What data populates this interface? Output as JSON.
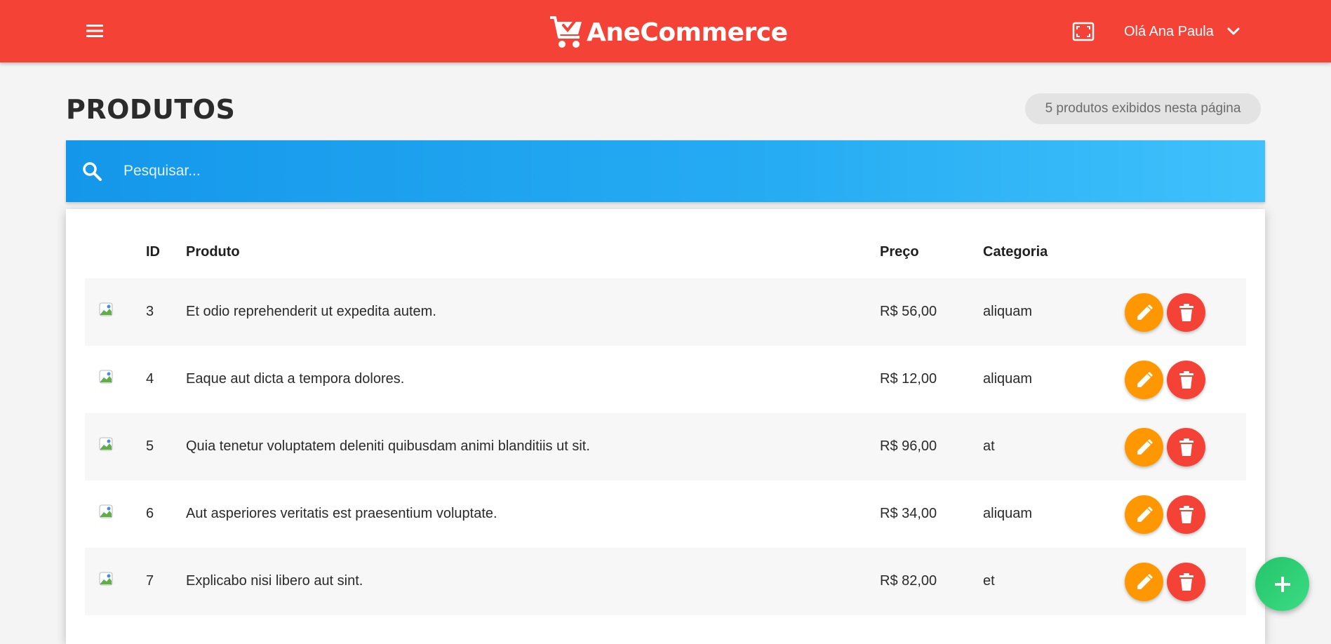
{
  "header": {
    "brand": "AneCommerce",
    "greeting": "Olá Ana Paula",
    "icons": [
      "menu-icon",
      "cart-check-icon",
      "fullscreen-icon",
      "chevron-down-icon"
    ],
    "color": "#f44336"
  },
  "page": {
    "title": "PRODUTOS",
    "count_badge": "5 produtos exibidos nesta página"
  },
  "search": {
    "placeholder": "Pesquisar...",
    "icon": "search-icon"
  },
  "table": {
    "columns": {
      "id": "ID",
      "product": "Produto",
      "price": "Preço",
      "category": "Categoria"
    },
    "rows": [
      {
        "id": "3",
        "product": "Et odio reprehenderit ut expedita autem.",
        "price": "R$ 56,00",
        "category": "aliquam"
      },
      {
        "id": "4",
        "product": "Eaque aut dicta a tempora dolores.",
        "price": "R$ 12,00",
        "category": "aliquam"
      },
      {
        "id": "5",
        "product": "Quia tenetur voluptatem deleniti quibusdam animi blanditiis ut sit.",
        "price": "R$ 96,00",
        "category": "at"
      },
      {
        "id": "6",
        "product": "Aut asperiores veritatis est praesentium voluptate.",
        "price": "R$ 34,00",
        "category": "aliquam"
      },
      {
        "id": "7",
        "product": "Explicabo nisi libero aut sint.",
        "price": "R$ 82,00",
        "category": "et"
      }
    ],
    "row_actions": [
      "pencil-icon",
      "trash-icon"
    ]
  },
  "fab": {
    "icon": "plus-icon",
    "color": "#2ecc71"
  },
  "colors": {
    "edit": "#ff9800",
    "delete": "#f44336",
    "search_bar": "#1e9ff0"
  }
}
